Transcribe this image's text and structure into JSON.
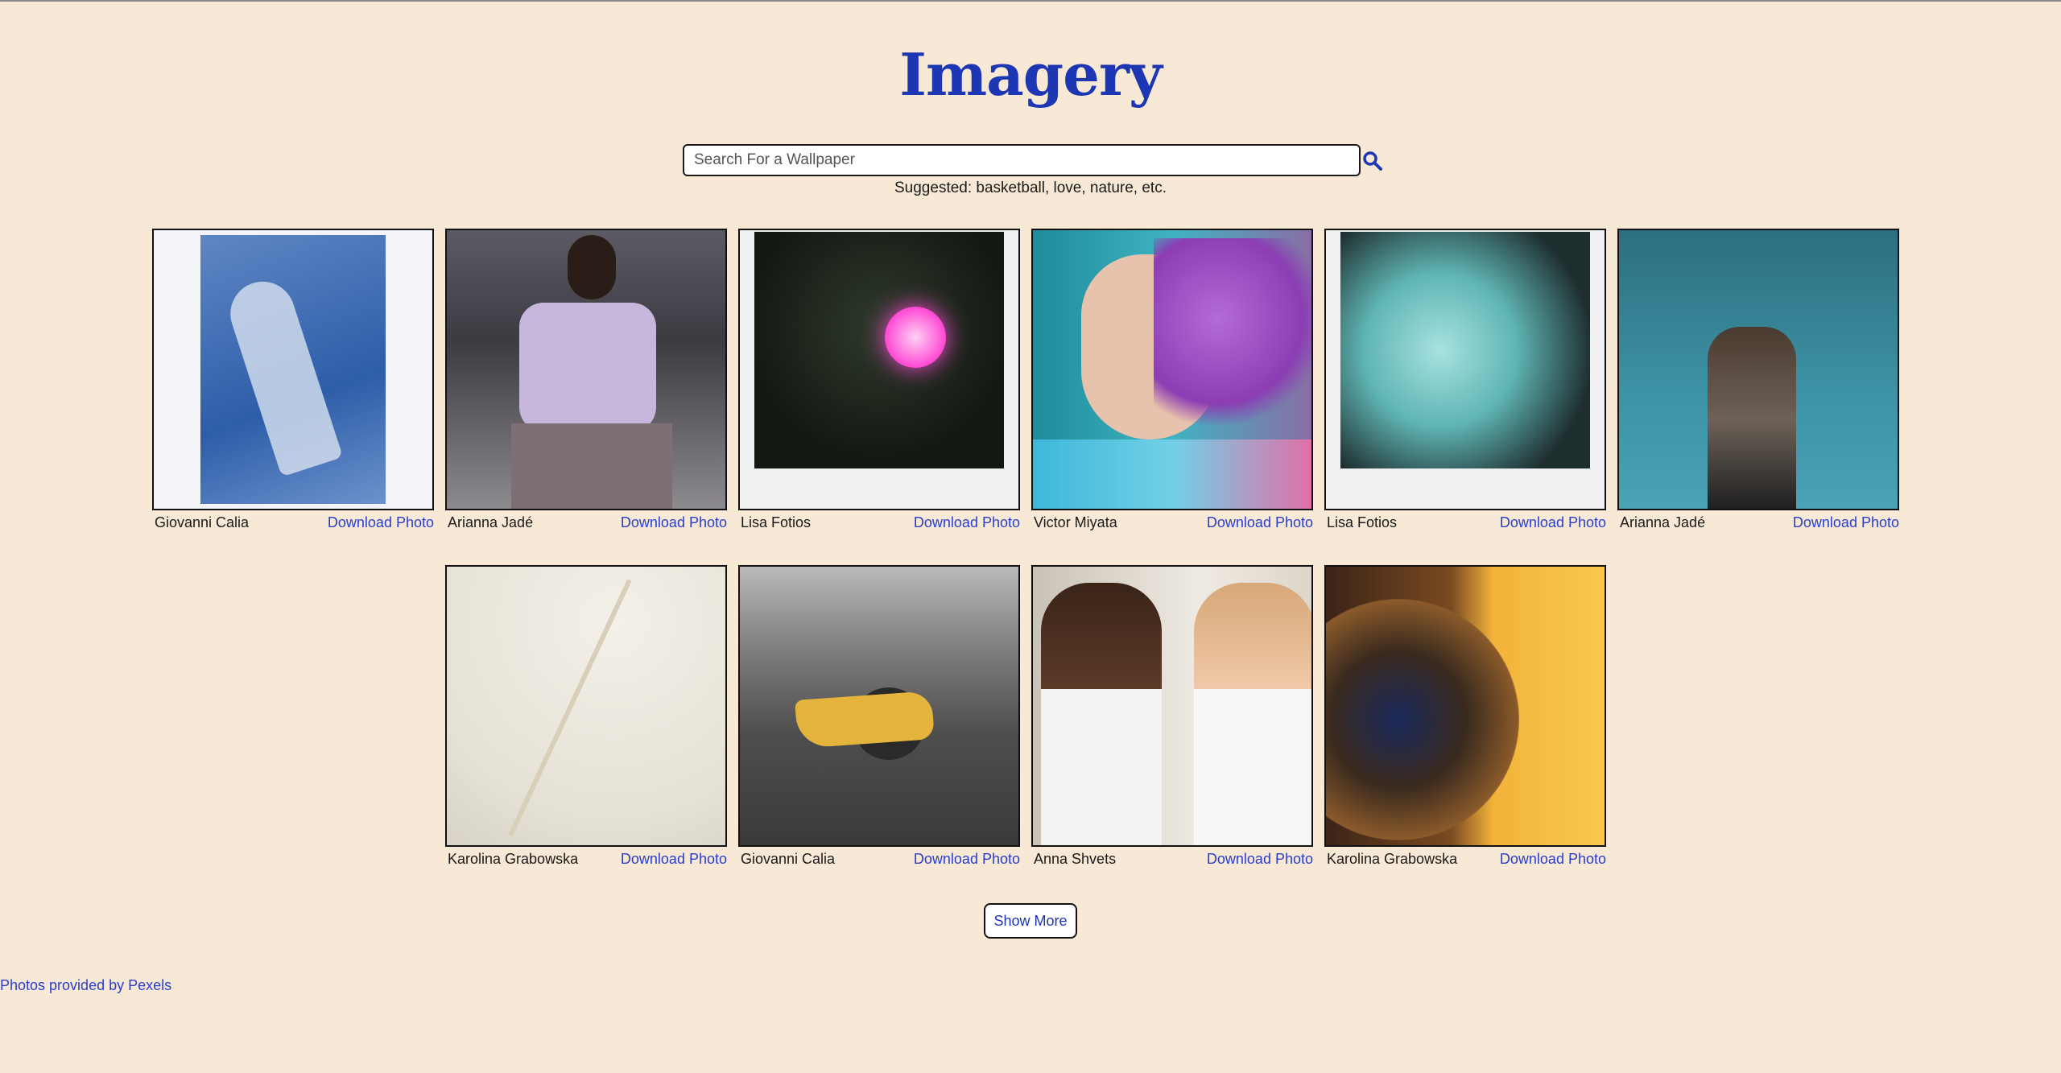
{
  "header": {
    "title": "Imagery"
  },
  "search": {
    "placeholder": "Search For a Wallpaper",
    "value": "",
    "suggested": "Suggested: basketball, love, nature, etc."
  },
  "photos": [
    {
      "author": "Giovanni Calia",
      "download_label": "Download Photo"
    },
    {
      "author": "Arianna Jadé",
      "download_label": "Download Photo"
    },
    {
      "author": "Lisa Fotios",
      "download_label": "Download Photo"
    },
    {
      "author": "Victor Miyata",
      "download_label": "Download Photo"
    },
    {
      "author": "Lisa Fotios",
      "download_label": "Download Photo"
    },
    {
      "author": "Arianna Jadé",
      "download_label": "Download Photo"
    },
    {
      "author": "Karolina Grabowska",
      "download_label": "Download Photo"
    },
    {
      "author": "Giovanni Calia",
      "download_label": "Download Photo"
    },
    {
      "author": "Anna Shvets",
      "download_label": "Download Photo"
    },
    {
      "author": "Karolina Grabowska",
      "download_label": "Download Photo"
    }
  ],
  "show_more_label": "Show More",
  "footer": {
    "credit": "Photos provided by Pexels"
  },
  "colors": {
    "background": "#f7e9d5",
    "accent": "#1c36b4",
    "link": "#2a3ec9"
  },
  "icons": {
    "search": "search-icon"
  }
}
